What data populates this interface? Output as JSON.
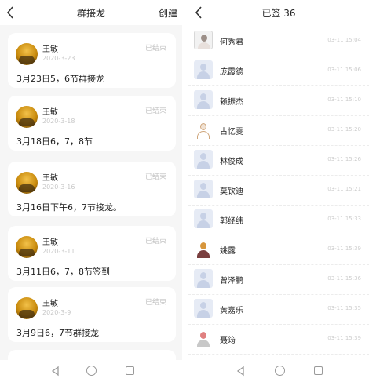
{
  "left": {
    "title": "群接龙",
    "action": "创建",
    "cards": [
      {
        "name": "王敏",
        "date": "2020-3-23",
        "status": "已结束",
        "content": "3月23日5，6节群接龙"
      },
      {
        "name": "王敏",
        "date": "2020-3-18",
        "status": "已结束",
        "content": "3月18日6，7，8节"
      },
      {
        "name": "王敏",
        "date": "2020-3-16",
        "status": "已结束",
        "content": "3月16日下午6，7节接龙。"
      },
      {
        "name": "王敏",
        "date": "2020-3-11",
        "status": "已结束",
        "content": "3月11日6，7，8节签到"
      },
      {
        "name": "王敏",
        "date": "2020-3-9",
        "status": "已结束",
        "content": "3月9日6，7节群接龙"
      }
    ]
  },
  "right": {
    "title": "已签 36",
    "rows": [
      {
        "name": "何秀君",
        "time": "03-11 15:04",
        "avatar": "photo"
      },
      {
        "name": "庞霞德",
        "time": "03-11 15:06",
        "avatar": "default"
      },
      {
        "name": "赖振杰",
        "time": "03-11 15:10",
        "avatar": "default"
      },
      {
        "name": "古忆雯",
        "time": "03-11 15:20",
        "avatar": "sketch"
      },
      {
        "name": "林俊成",
        "time": "03-11 15:26",
        "avatar": "default"
      },
      {
        "name": "莫钦迪",
        "time": "03-11 15:21",
        "avatar": "default"
      },
      {
        "name": "郭经纬",
        "time": "03-11 15:33",
        "avatar": "default"
      },
      {
        "name": "姚露",
        "time": "03-11 15:39",
        "avatar": "cartoon"
      },
      {
        "name": "曾泽鹏",
        "time": "03-11 15:36",
        "avatar": "default"
      },
      {
        "name": "黄嘉乐",
        "time": "03-11 15:35",
        "avatar": "default"
      },
      {
        "name": "聂筠",
        "time": "03-11 15:39",
        "avatar": "flower"
      }
    ]
  },
  "colors": {
    "background": "#f6f6f6",
    "card": "#ffffff",
    "muted_text": "#c4c4c4",
    "text": "#222222"
  },
  "icons": [
    "back-chevron-icon",
    "nav-back-triangle-icon",
    "nav-home-circle-icon",
    "nav-recent-square-icon"
  ]
}
